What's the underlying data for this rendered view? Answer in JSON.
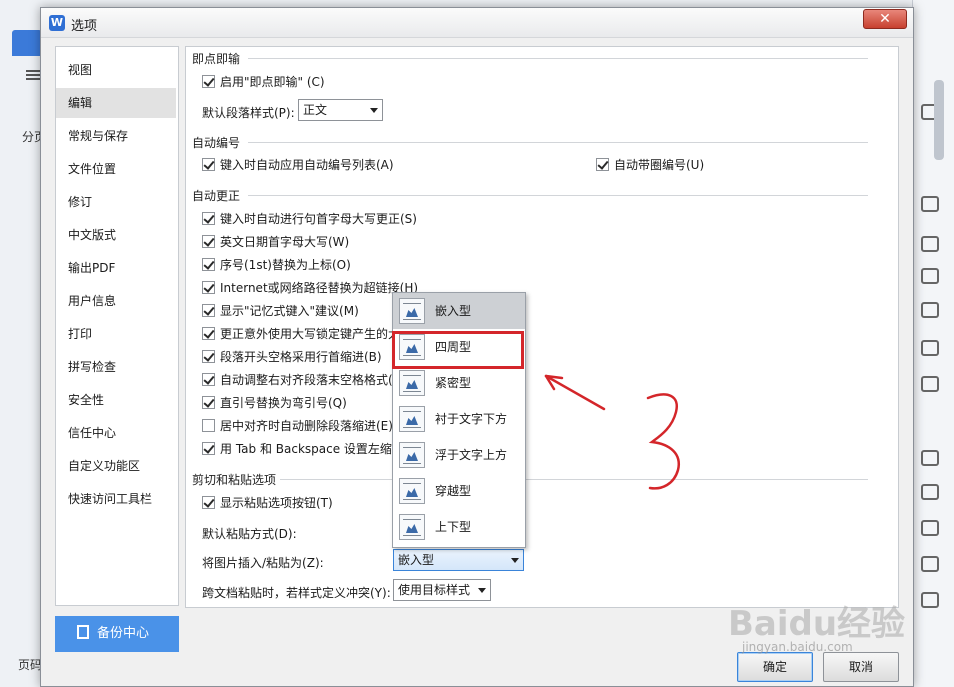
{
  "background": {
    "left_text": "分页",
    "bottom_text": "页码"
  },
  "dialog": {
    "title": "选项",
    "app_icon": "W",
    "close_label": "✕",
    "sidebar": {
      "items": [
        "视图",
        "编辑",
        "常规与保存",
        "文件位置",
        "修订",
        "中文版式",
        "输出PDF",
        "用户信息",
        "打印",
        "拼写检查",
        "安全性",
        "信任中心",
        "自定义功能区",
        "快速访问工具栏"
      ],
      "active_index": 1,
      "backup_label": "备份中心"
    },
    "sections": {
      "click_input": {
        "title": "即点即输",
        "enable_label": "启用\"即点即输\" (C)",
        "default_style_label": "默认段落样式(P):",
        "default_style_value": "正文"
      },
      "auto_number": {
        "title": "自动编号",
        "apply_label": "键入时自动应用自动编号列表(A)",
        "circled_label": "自动带圈编号(U)"
      },
      "auto_correct": {
        "title": "自动更正",
        "items": [
          "键入时自动进行句首字母大写更正(S)",
          "英文日期首字母大写(W)",
          "序号(1st)替换为上标(O)",
          "Internet或网络路径替换为超链接(H)",
          "显示\"记忆式键入\"建议(M)",
          "更正意外使用大写锁定键产生的大",
          "段落开头空格采用行首缩进(B)",
          "自动调整右对齐段落末空格格式(I",
          "直引号替换为弯引号(Q)",
          "居中对齐时自动删除段落缩进(E)",
          "用 Tab 和 Backspace 设置左缩"
        ],
        "checked": [
          true,
          true,
          true,
          true,
          true,
          true,
          true,
          true,
          true,
          false,
          true
        ]
      },
      "paste": {
        "title": "剪切和粘贴选项",
        "show_button_label": "显示粘贴选项按钮(T)",
        "default_paste_label": "默认粘贴方式(D):",
        "insert_picture_label": "将图片插入/粘贴为(Z):",
        "insert_picture_value": "嵌入型",
        "cross_doc_label": "跨文档粘贴时，若样式定义冲突(Y):",
        "cross_doc_value": "使用目标样式"
      }
    },
    "dropdown_options": [
      "嵌入型",
      "四周型",
      "紧密型",
      "衬于文字下方",
      "浮于文字上方",
      "穿越型",
      "上下型"
    ],
    "dropdown_hover_index": 0,
    "dropdown_highlight_index": 1,
    "buttons": {
      "ok": "确定",
      "cancel": "取消"
    }
  },
  "annotations": {
    "color": "#d4262a"
  },
  "watermark": {
    "main": "Baidu经验",
    "sub": "jingyan.baidu.com"
  }
}
